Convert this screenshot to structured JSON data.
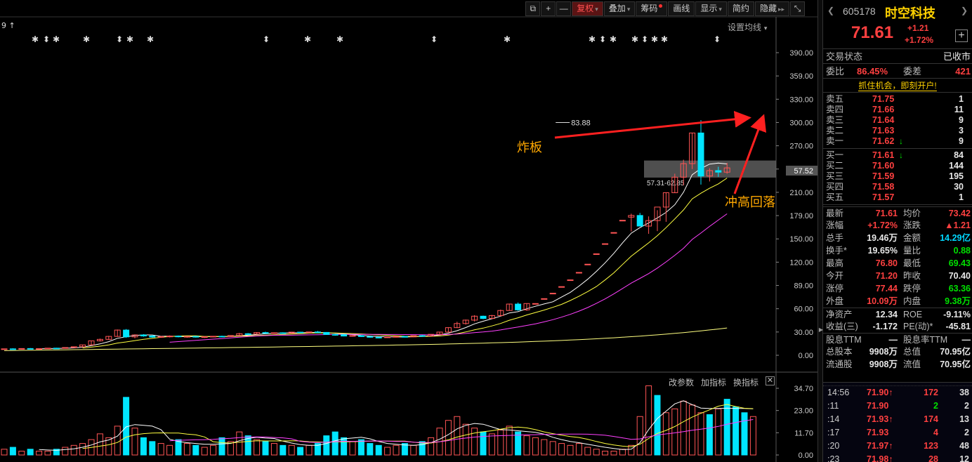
{
  "toolbar": {
    "buttons": [
      "复权",
      "叠加",
      "筹码",
      "画线",
      "显示",
      "简约",
      "隐藏"
    ],
    "icons": [
      "restore-icon",
      "plus-icon",
      "minus-icon"
    ],
    "window_icon": "shrink-icon"
  },
  "chart": {
    "set_ma_label": "设置均线",
    "top_left_label": "9",
    "high_label": "83.88",
    "current_price_tag": "57.52",
    "range_label": "57.31-62.85",
    "annotation_1": "炸板",
    "annotation_2": "冲高回落",
    "vol_buttons": [
      "改参数",
      "加指标",
      "换指标"
    ],
    "colors": {
      "up": "#ff5555",
      "down": "#00e5ff",
      "ma5": "#ffffff",
      "ma10": "#ffff40",
      "ma20": "#ff40ff",
      "ma60": "#ffff80",
      "annotation": "#ffa800",
      "arrow": "#ff2020"
    }
  },
  "chart_data": [
    {
      "type": "candlestick",
      "title": "",
      "y_ticks": [
        "390.00",
        "359.00",
        "330.00",
        "300.00",
        "270.00",
        "240.00",
        "210.00",
        "179.00",
        "150.00",
        "120.00",
        "89.00",
        "60.00",
        "30.00",
        "0.00"
      ],
      "high_marker": 83.88,
      "ohlc": [
        [
          7.5,
          8.6,
          7.2,
          8.3
        ],
        [
          8.3,
          9.0,
          7.9,
          8.1
        ],
        [
          8.1,
          8.8,
          7.6,
          8.7
        ],
        [
          8.7,
          9.3,
          8.2,
          8.4
        ],
        [
          8.4,
          9.0,
          7.9,
          8.6
        ],
        [
          8.6,
          9.4,
          8.2,
          9.2
        ],
        [
          9.2,
          9.6,
          8.7,
          8.9
        ],
        [
          8.9,
          10.2,
          8.5,
          10.0
        ],
        [
          10.0,
          11.2,
          9.6,
          11.0
        ],
        [
          11.0,
          13.6,
          10.7,
          13.4
        ],
        [
          13.4,
          18.7,
          13.0,
          18.6
        ],
        [
          18.6,
          21.5,
          17.8,
          20.5
        ],
        [
          20.5,
          25.0,
          19.8,
          24.3
        ],
        [
          24.3,
          33.2,
          23.8,
          32.5
        ],
        [
          32.5,
          33.8,
          22.5,
          23.7
        ],
        [
          23.7,
          26.9,
          21.8,
          26.2
        ],
        [
          26.2,
          27.2,
          23.9,
          24.9
        ],
        [
          24.9,
          26.1,
          22.6,
          23.4
        ],
        [
          23.4,
          24.8,
          22.5,
          24.1
        ],
        [
          24.1,
          25.6,
          23.0,
          24.7
        ],
        [
          24.7,
          25.4,
          23.1,
          23.8
        ],
        [
          23.8,
          24.8,
          22.6,
          24.3
        ],
        [
          24.3,
          24.6,
          22.8,
          23.5
        ],
        [
          23.5,
          24.1,
          22.3,
          23.9
        ],
        [
          23.9,
          24.9,
          23.4,
          24.5
        ],
        [
          24.5,
          25.2,
          23.6,
          24.1
        ],
        [
          24.1,
          25.8,
          23.8,
          25.5
        ],
        [
          25.5,
          28.8,
          25.1,
          27.8
        ],
        [
          27.8,
          28.6,
          26.1,
          27.4
        ],
        [
          27.4,
          29.8,
          26.9,
          29.3
        ],
        [
          29.3,
          30.4,
          27.9,
          28.6
        ],
        [
          28.6,
          29.5,
          27.6,
          29.0
        ],
        [
          29.0,
          29.6,
          28.2,
          28.5
        ],
        [
          28.5,
          30.3,
          28.1,
          29.8
        ],
        [
          29.8,
          30.2,
          28.7,
          29.1
        ],
        [
          29.1,
          30.3,
          28.8,
          30.1
        ],
        [
          30.1,
          31.4,
          29.2,
          29.5
        ],
        [
          29.5,
          29.9,
          26.5,
          26.8
        ],
        [
          26.8,
          27.6,
          25.2,
          26.6
        ],
        [
          26.6,
          27.3,
          24.3,
          24.8
        ],
        [
          24.8,
          25.9,
          24.0,
          25.4
        ],
        [
          25.4,
          25.8,
          23.7,
          24.1
        ],
        [
          24.1,
          24.6,
          22.6,
          23.2
        ],
        [
          23.2,
          23.8,
          22.2,
          22.9
        ],
        [
          22.9,
          24.1,
          22.5,
          23.6
        ],
        [
          23.6,
          24.6,
          23.0,
          24.2
        ],
        [
          24.2,
          24.9,
          23.4,
          23.7
        ],
        [
          23.7,
          25.6,
          23.2,
          25.3
        ],
        [
          25.3,
          26.2,
          24.4,
          24.9
        ],
        [
          24.9,
          27.2,
          24.7,
          27.0
        ],
        [
          27.0,
          30.3,
          26.7,
          29.9
        ],
        [
          29.9,
          36.0,
          29.6,
          35.6
        ],
        [
          35.6,
          43.2,
          35.1,
          40.9
        ],
        [
          40.9,
          46.0,
          39.5,
          45.3
        ],
        [
          45.3,
          51.7,
          43.6,
          50.4
        ],
        [
          50.4,
          51.1,
          46.5,
          47.4
        ],
        [
          47.4,
          52.0,
          47.0,
          51.2
        ],
        [
          51.2,
          58.9,
          50.2,
          57.7
        ],
        [
          57.7,
          66.6,
          57.5,
          66.0
        ],
        [
          66.0,
          68.0,
          57.3,
          58.5
        ],
        [
          58.5,
          67.0,
          57.3,
          66.7
        ],
        [
          66.7,
          66.7,
          66.7,
          66.7
        ],
        [
          73.0,
          73.0,
          73.0,
          73.0
        ],
        [
          80.0,
          80.0,
          80.0,
          80.0
        ],
        [
          88.5,
          88.5,
          88.5,
          88.5
        ],
        [
          97.2,
          97.2,
          97.2,
          97.2
        ],
        [
          106.8,
          106.8,
          106.8,
          106.8
        ],
        [
          117.4,
          117.4,
          117.4,
          117.4
        ],
        [
          130.8,
          130.8,
          130.8,
          130.8
        ],
        [
          143.8,
          143.8,
          143.8,
          143.8
        ],
        [
          158.2,
          158.2,
          158.2,
          158.2
        ],
        [
          174.0,
          174.0,
          174.0,
          174.0
        ],
        [
          178.0,
          182.5,
          159.6,
          180.2
        ],
        [
          180.2,
          183.5,
          170.0,
          166.5
        ],
        [
          166.5,
          179.0,
          156.5,
          173.6
        ],
        [
          173.6,
          187.0,
          160.0,
          191.0
        ],
        [
          191.0,
          210.0,
          172.0,
          209.5
        ],
        [
          209.5,
          234.0,
          209.0,
          229.5
        ],
        [
          229.5,
          252.0,
          219.0,
          247.0
        ],
        [
          247.0,
          286.5,
          240.0,
          286.5
        ],
        [
          286.5,
          303.0,
          220.0,
          231.0
        ],
        [
          231.0,
          241.0,
          224.0,
          238.0
        ],
        [
          238.0,
          243.0,
          230.0,
          236.0
        ],
        [
          236.0,
          248.0,
          234.0,
          241.5
        ]
      ]
    },
    {
      "type": "bar",
      "title": "",
      "y_ticks": [
        "34.70",
        "23.00",
        "11.70",
        "0.00"
      ],
      "values": [
        3,
        4,
        2,
        3,
        2,
        2,
        3,
        4,
        5,
        6,
        8,
        11,
        9,
        15,
        30,
        14,
        9,
        7,
        6,
        5,
        8,
        6,
        5,
        4,
        5,
        9,
        7,
        12,
        10,
        8,
        7,
        6,
        5,
        5,
        4,
        5,
        6,
        10,
        12,
        9,
        7,
        8,
        6,
        5,
        4,
        5,
        6,
        5,
        7,
        9,
        14,
        18,
        20,
        16,
        14,
        12,
        11,
        13,
        15,
        12,
        10,
        9,
        8,
        7,
        6,
        5,
        6,
        4,
        3,
        2,
        2,
        3,
        5,
        20,
        36,
        31,
        22,
        24,
        28,
        26,
        22,
        21,
        24,
        29,
        25,
        22,
        20
      ],
      "up": [
        true,
        false,
        true,
        false,
        true,
        true,
        false,
        true,
        true,
        true,
        true,
        true,
        true,
        true,
        false,
        true,
        false,
        false,
        true,
        true,
        false,
        true,
        false,
        true,
        true,
        false,
        true,
        true,
        false,
        true,
        false,
        true,
        false,
        true,
        false,
        true,
        false,
        false,
        false,
        false,
        true,
        false,
        false,
        false,
        true,
        true,
        false,
        true,
        false,
        true,
        true,
        true,
        true,
        true,
        true,
        false,
        true,
        true,
        true,
        false,
        true,
        true,
        true,
        true,
        true,
        true,
        true,
        true,
        true,
        true,
        true,
        true,
        true,
        true,
        true,
        false,
        true,
        true,
        true,
        true,
        true,
        false,
        true,
        false,
        false,
        false,
        true
      ]
    }
  ],
  "quote": {
    "code": "605178",
    "name": "时空科技",
    "price": "71.61",
    "change": "+1.21",
    "change_pct": "+1.72%",
    "status_label": "交易状态",
    "status_value": "已收市",
    "weibi_label": "委比",
    "weibi_value": "86.45%",
    "weicha_label": "委差",
    "weicha_value": "421",
    "ad_text": "抓住机会，即刻开户!",
    "asks": [
      {
        "label": "卖五",
        "price": "71.75",
        "arrow": "",
        "vol": "1"
      },
      {
        "label": "卖四",
        "price": "71.66",
        "arrow": "",
        "vol": "11"
      },
      {
        "label": "卖三",
        "price": "71.64",
        "arrow": "",
        "vol": "9"
      },
      {
        "label": "卖二",
        "price": "71.63",
        "arrow": "",
        "vol": "3"
      },
      {
        "label": "卖一",
        "price": "71.62",
        "arrow": "↓",
        "vol": "9"
      }
    ],
    "bids": [
      {
        "label": "买一",
        "price": "71.61",
        "arrow": "↓",
        "vol": "84"
      },
      {
        "label": "买二",
        "price": "71.60",
        "arrow": "",
        "vol": "144"
      },
      {
        "label": "买三",
        "price": "71.59",
        "arrow": "",
        "vol": "195"
      },
      {
        "label": "买四",
        "price": "71.58",
        "arrow": "",
        "vol": "30"
      },
      {
        "label": "买五",
        "price": "71.57",
        "arrow": "",
        "vol": "1"
      }
    ],
    "stats": [
      {
        "l1": "最新",
        "v1": "71.61",
        "c1": "red",
        "l2": "均价",
        "v2": "73.42",
        "c2": "red"
      },
      {
        "l1": "涨幅",
        "v1": "+1.72%",
        "c1": "red",
        "l2": "涨跌",
        "v2": "▲1.21",
        "c2": "red"
      },
      {
        "l1": "总手",
        "v1": "19.46万",
        "c1": "white",
        "l2": "金额",
        "v2": "14.29亿",
        "c2": "cyan"
      },
      {
        "l1": "换手*",
        "v1": "19.65%",
        "c1": "white",
        "l2": "量比",
        "v2": "0.88",
        "c2": "green"
      },
      {
        "l1": "最高",
        "v1": "76.80",
        "c1": "red",
        "l2": "最低",
        "v2": "69.43",
        "c2": "green"
      },
      {
        "l1": "今开",
        "v1": "71.20",
        "c1": "red",
        "l2": "昨收",
        "v2": "70.40",
        "c2": "white"
      },
      {
        "l1": "涨停",
        "v1": "77.44",
        "c1": "red",
        "l2": "跌停",
        "v2": "63.36",
        "c2": "green"
      },
      {
        "l1": "外盘",
        "v1": "10.09万",
        "c1": "red",
        "l2": "内盘",
        "v2": "9.38万",
        "c2": "green"
      },
      {
        "l1": "净资产",
        "v1": "12.34",
        "c1": "white",
        "l2": "ROE",
        "v2": "-9.11%",
        "c2": "white"
      },
      {
        "l1": "收益(三)",
        "v1": "-1.172",
        "c1": "white",
        "l2": "PE(动)*",
        "v2": "-45.81",
        "c2": "white"
      },
      {
        "l1": "股息TTM",
        "v1": "—",
        "c1": "white",
        "l2": "股息率TTM",
        "v2": "—",
        "c2": "white"
      },
      {
        "l1": "总股本",
        "v1": "9908万",
        "c1": "white",
        "l2": "总值",
        "v2": "70.95亿",
        "c2": "white"
      },
      {
        "l1": "流通股",
        "v1": "9908万",
        "c1": "white",
        "l2": "流值",
        "v2": "70.95亿",
        "c2": "white"
      }
    ],
    "ticks": [
      {
        "time": "14:56",
        "price": "71.90",
        "arrow": "↑",
        "vol": "172",
        "vol_color": "red",
        "n": "38"
      },
      {
        "time": ":11",
        "price": "71.90",
        "arrow": "",
        "vol": "2",
        "vol_color": "green",
        "n": "2"
      },
      {
        "time": ":14",
        "price": "71.93",
        "arrow": "↑",
        "vol": "174",
        "vol_color": "red",
        "n": "13"
      },
      {
        "time": ":17",
        "price": "71.93",
        "arrow": "",
        "vol": "4",
        "vol_color": "red",
        "n": "2"
      },
      {
        "time": ":20",
        "price": "71.97",
        "arrow": "↑",
        "vol": "123",
        "vol_color": "red",
        "n": "48"
      },
      {
        "time": ":23",
        "price": "71.98",
        "arrow": "↑",
        "vol": "28",
        "vol_color": "red",
        "n": "12"
      }
    ]
  }
}
